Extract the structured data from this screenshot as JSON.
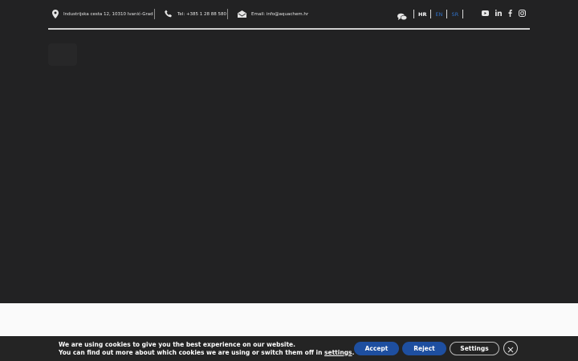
{
  "topbar": {
    "address": "Industrijska cesta 12, 10310 Ivanić-Grad",
    "phone": "Tel: +385 1 28 88 580",
    "email": "Email: info@aquachem.hr",
    "languages": [
      "HR",
      "EN",
      "SR"
    ],
    "active_language": "HR",
    "icons": [
      "map-pin-icon",
      "phone-icon",
      "envelope-icon",
      "chat-icon"
    ],
    "social_icons": [
      "youtube-icon",
      "linkedin-icon",
      "facebook-icon",
      "instagram-icon"
    ]
  },
  "cookie": {
    "line1": "We are using cookies to give you the best experience on our website.",
    "line2_prefix": "You can find out more about which cookies we are using or switch them off in ",
    "line2_link": "settings",
    "line2_suffix": ".",
    "accept_label": "Accept",
    "reject_label": "Reject",
    "settings_label": "Settings"
  },
  "colors": {
    "page_bg": "#222223",
    "accent": "#1e4fa0",
    "link_lang": "#2f6fc4"
  }
}
